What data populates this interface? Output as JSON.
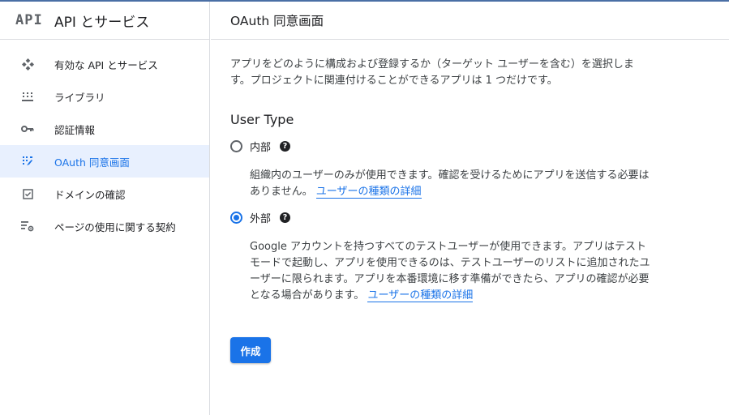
{
  "sidebar": {
    "logo": "API",
    "title": "API とサービス",
    "items": [
      {
        "label": "有効な API とサービス",
        "icon": "enabled-apis-icon"
      },
      {
        "label": "ライブラリ",
        "icon": "library-icon"
      },
      {
        "label": "認証情報",
        "icon": "key-icon"
      },
      {
        "label": "OAuth 同意画面",
        "icon": "oauth-consent-icon",
        "active": true
      },
      {
        "label": "ドメインの確認",
        "icon": "checkbox-icon"
      },
      {
        "label": "ページの使用に関する契約",
        "icon": "settings-list-icon"
      }
    ]
  },
  "main": {
    "title": "OAuth 同意画面",
    "intro": "アプリをどのように構成および登録するか（ターゲット ユーザーを含む）を選択します。プロジェクトに関連付けることができるアプリは 1 つだけです。",
    "user_type_title": "User Type",
    "options": {
      "internal": {
        "label": "内部",
        "checked": false,
        "description": "組織内のユーザーのみが使用できます。確認を受けるためにアプリを送信する必要はありません。",
        "link": "ユーザーの種類の詳細"
      },
      "external": {
        "label": "外部",
        "checked": true,
        "description": "Google アカウントを持つすべてのテストユーザーが使用できます。アプリはテストモードで起動し、アプリを使用できるのは、テストユーザーのリストに追加されたユーザーに限られます。アプリを本番環境に移す準備ができたら、アプリの確認が必要となる場合があります。",
        "link": "ユーザーの種類の詳細"
      }
    },
    "help_glyph": "?",
    "create_label": "作成"
  },
  "colors": {
    "accent": "#1a73e8",
    "active_bg": "#e8f0fe",
    "divider": "#dadce0"
  }
}
